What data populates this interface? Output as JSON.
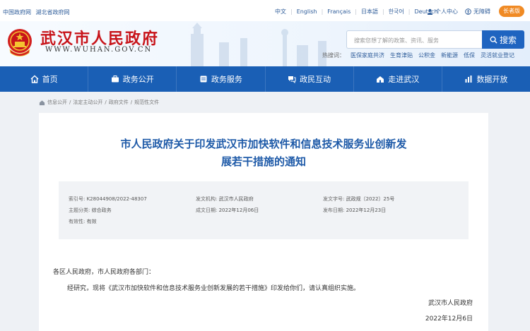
{
  "topbar": {
    "portal_links": [
      "中国政府网",
      "湖北省政府网"
    ],
    "languages": [
      "中文",
      "English",
      "Français",
      "日本語",
      "한국어",
      "Deutsch"
    ],
    "user_center": "个人中心",
    "barrier_free": "无障碍",
    "elder_mode": "长者版"
  },
  "header": {
    "site_title": "武汉市人民政府",
    "site_domain": "WWW.WUHAN.GOV.CN",
    "search": {
      "placeholder": "搜索您想了解的政策、资讯、服务",
      "button_label": "搜索"
    },
    "hot_label": "热搜词：",
    "hot_words": [
      "医保家庭共济",
      "生育津贴",
      "公积金",
      "新能源",
      "低保",
      "灵活就业登记"
    ]
  },
  "nav": {
    "items": [
      {
        "label": "首页",
        "icon": "home-icon"
      },
      {
        "label": "政务公开",
        "icon": "briefcase-icon"
      },
      {
        "label": "政务服务",
        "icon": "service-icon"
      },
      {
        "label": "政民互动",
        "icon": "interaction-icon"
      },
      {
        "label": "走进武汉",
        "icon": "city-icon"
      },
      {
        "label": "数据开放",
        "icon": "chart-icon"
      }
    ]
  },
  "breadcrumb": [
    "信息公开",
    "法定主动公开",
    "政府文件",
    "规范性文件"
  ],
  "doc": {
    "title_line1": "市人民政府关于印发武汉市加快软件和信息技术服务业创新发",
    "title_line2": "展若干措施的通知",
    "meta": {
      "index_label": "索引号:",
      "index_value": "K28044908/2022-48307",
      "issuer_label": "发文机构:",
      "issuer_value": "武汉市人民政府",
      "docno_label": "发文字号:",
      "docno_value": "武政规〔2022〕25号",
      "category_label": "主题分类:",
      "category_value": "综合政务",
      "created_label": "成文日期:",
      "created_value": "2022年12月06日",
      "published_label": "发布日期:",
      "published_value": "2022年12月23日",
      "validity_label": "有效性:",
      "validity_value": "有效"
    },
    "salutation": "各区人民政府，市人民政府各部门：",
    "paragraph": "经研究，现将《武汉市加快软件和信息技术服务业创新发展的若干措施》印发给你们，请认真组织实施。",
    "signature": "武汉市人民政府",
    "date": "2022年12月6日"
  },
  "colors": {
    "brand_red": "#c8141a",
    "nav_blue": "#1a5fb5",
    "title_blue": "#1e5aa8",
    "elder_orange": "#f08a24"
  }
}
